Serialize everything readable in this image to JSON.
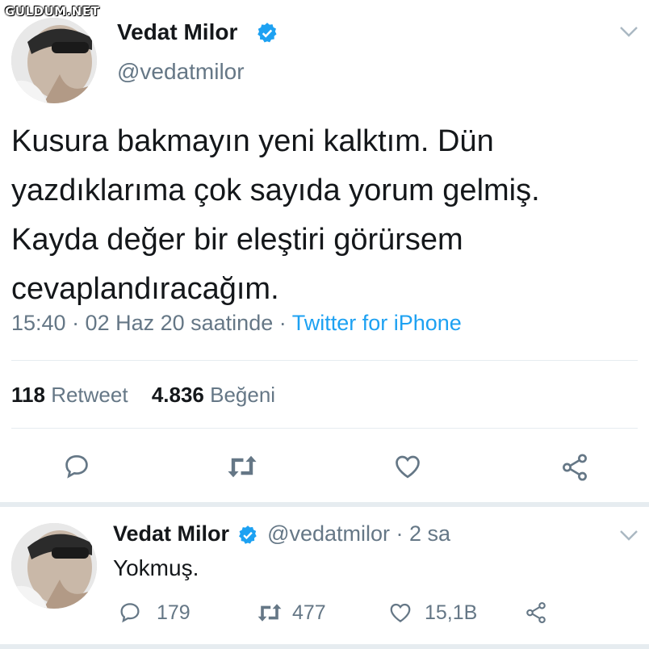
{
  "watermark": "GULDUM.NET",
  "main_tweet": {
    "name": "Vedat Milor",
    "handle": "@vedatmilor",
    "text_lines": [
      "Kusura bakmayın yeni kalktım. Dün",
      "yazdıklarıma çok sayıda yorum gelmiş.",
      "Kayda değer bir eleştiri görürsem",
      "cevaplandıracağım."
    ],
    "time": "15:40 · 02 Haz 20 saatinde · ",
    "source": "Twitter for iPhone",
    "retweets_count": "118",
    "retweets_label": "Retweet",
    "likes_count": "4.836",
    "likes_label": "Beğeni",
    "icons": [
      "reply-icon",
      "retweet-icon",
      "like-icon",
      "share-icon"
    ]
  },
  "reply_tweet": {
    "name": "Vedat Milor",
    "handle_time": "@vedatmilor · 2 sa",
    "text": "Yokmuş.",
    "reply_count": "179",
    "retweet_count": "477",
    "like_count": "15,1B"
  },
  "colors": {
    "accent": "#1da1f2",
    "muted": "#657786",
    "text": "#14171a",
    "divider": "#e6ecf0"
  }
}
